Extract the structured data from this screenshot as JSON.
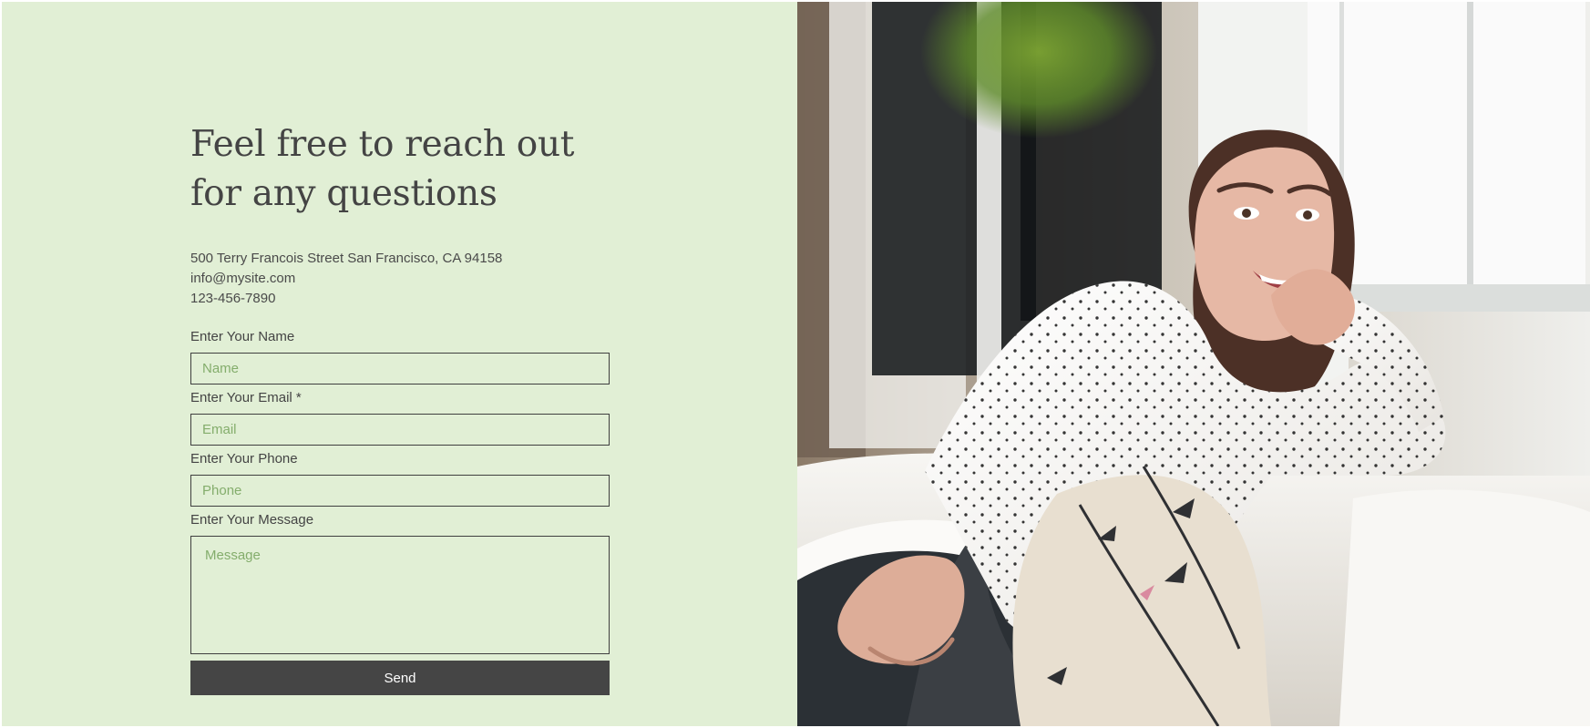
{
  "contact": {
    "headline": "Feel free to reach out for any questions",
    "address": "500 Terry Francois Street San Francisco, CA 94158",
    "email": "info@mysite.com",
    "phone": "123-456-7890"
  },
  "form": {
    "name": {
      "label": "Enter Your Name",
      "placeholder": "Name"
    },
    "email": {
      "label": "Enter Your Email *",
      "placeholder": "Email"
    },
    "phone": {
      "label": "Enter Your Phone",
      "placeholder": "Phone"
    },
    "message": {
      "label": "Enter Your Message",
      "placeholder": "Message"
    },
    "send_label": "Send"
  },
  "colors": {
    "panel_background": "#e1efd5",
    "text": "#444444",
    "placeholder": "#84ad6c",
    "button": "#454545",
    "button_text": "#ffffff"
  },
  "icons": {
    "photo": "smiling-woman-on-sofa-image"
  }
}
